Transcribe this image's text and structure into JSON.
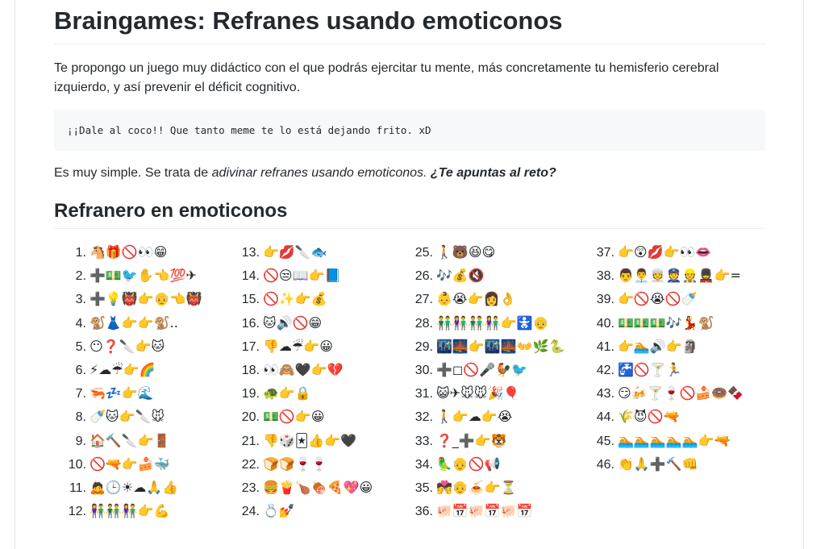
{
  "title": "Braingames: Refranes usando emoticonos",
  "intro": "Te propongo un juego muy didáctico con el que podrás ejercitar tu mente, más concretamente tu hemisferio cerebral izquierdo, y así prevenir el déficit cognitivo.",
  "code_quote": "¡¡Dale al coco!! Que tanto meme te lo está dejando frito. xD",
  "desc": {
    "prefix": "Es muy simple. Se trata de ",
    "emphasis": "adivinar refranes usando emoticonos.",
    "call_to_action": "¿Te apuntas al reto?"
  },
  "section_title": "Refranero en emoticonos",
  "refranes": [
    {
      "num": "1.",
      "emojis": "🐴🎁🚫👀😁"
    },
    {
      "num": "2.",
      "emojis": "➕💵🐦✋👈💯✈"
    },
    {
      "num": "3.",
      "emojis": "➕💡👹👉👴👈👹"
    },
    {
      "num": "4.",
      "emojis": "🐒👗👉👉🐒.."
    },
    {
      "num": "5.",
      "emojis": "😶❓🔪👉🐱"
    },
    {
      "num": "6.",
      "emojis": "⚡☁☔👉🌈"
    },
    {
      "num": "7.",
      "emojis": "🦐💤👉🌊"
    },
    {
      "num": "8.",
      "emojis": "🍼🐱👉🔪🐭"
    },
    {
      "num": "9.",
      "emojis": "🏠🔨🔪👉🚪"
    },
    {
      "num": "10.",
      "emojis": "🚫🔫👉🍰🐳"
    },
    {
      "num": "11.",
      "emojis": "🙇🕒☀☁🙏👍"
    },
    {
      "num": "12.",
      "emojis": "👫👬👫👉💪"
    },
    {
      "num": "13.",
      "emojis": "👉💋🔪🐟"
    },
    {
      "num": "14.",
      "emojis": "🚫😒📖👉📘"
    },
    {
      "num": "15.",
      "emojis": "🚫✨👉💰"
    },
    {
      "num": "16.",
      "emojis": "🐱🔊🚫😁"
    },
    {
      "num": "17.",
      "emojis": "👎☁☔👉😀"
    },
    {
      "num": "18.",
      "emojis": "👀🙈🖤👉💔"
    },
    {
      "num": "19.",
      "emojis": "🐢👉🔒"
    },
    {
      "num": "20.",
      "emojis": "💵🚫👉😀"
    },
    {
      "num": "21.",
      "emojis": "👎🎲🃏👍👉🖤"
    },
    {
      "num": "22.",
      "emojis": "🍞🍞🍷🍷"
    },
    {
      "num": "23.",
      "emojis": "🍔🍟🍗🍖🍕💖😀"
    },
    {
      "num": "24.",
      "emojis": "💍💅"
    },
    {
      "num": "25.",
      "emojis": "🚶🐻😆😋"
    },
    {
      "num": "26.",
      "emojis": "🎶💰🔇"
    },
    {
      "num": "27.",
      "emojis": "👶😭👉👩👌"
    },
    {
      "num": "28.",
      "emojis": "👬👫👬👫👉🚼👴"
    },
    {
      "num": "29.",
      "emojis": "🌃🌉👉🌃🌉👐🌿🐍"
    },
    {
      "num": "30.",
      "emojis": "➕◻🚫🎤🐓🐦"
    },
    {
      "num": "31.",
      "emojis": "😺✈🐭🐭🎉🎈"
    },
    {
      "num": "32.",
      "emojis": "🚶👉☁👉😭"
    },
    {
      "num": "33.",
      "emojis": "❓_➕👉🐯"
    },
    {
      "num": "34.",
      "emojis": "🦜👴🚫📢"
    },
    {
      "num": "35.",
      "emojis": "💏👴🍝👉⏳"
    },
    {
      "num": "36.",
      "emojis": "🐖📅🐖📅🐖📅"
    },
    {
      "num": "37.",
      "emojis": "👉😲💋👉👀👄"
    },
    {
      "num": "38.",
      "emojis": "👨👨‍💼👳👮👷💂👉="
    },
    {
      "num": "39.",
      "emojis": "👉🚫😭🚫🍼"
    },
    {
      "num": "40.",
      "emojis": "💵💵💵🎶💃🐒"
    },
    {
      "num": "41.",
      "emojis": "👉🏊🔊👉🗿"
    },
    {
      "num": "42.",
      "emojis": "🚰🚫🍸🏃"
    },
    {
      "num": "43.",
      "emojis": "😏🍻🍸🍷🚫🍰🍩🍫"
    },
    {
      "num": "44.",
      "emojis": "🌾😈🚫🔫"
    },
    {
      "num": "45.",
      "emojis": "🏊🏊🏊🏊🏊👉🔫"
    },
    {
      "num": "46.",
      "emojis": "👏🙏➕🔨👊"
    }
  ]
}
